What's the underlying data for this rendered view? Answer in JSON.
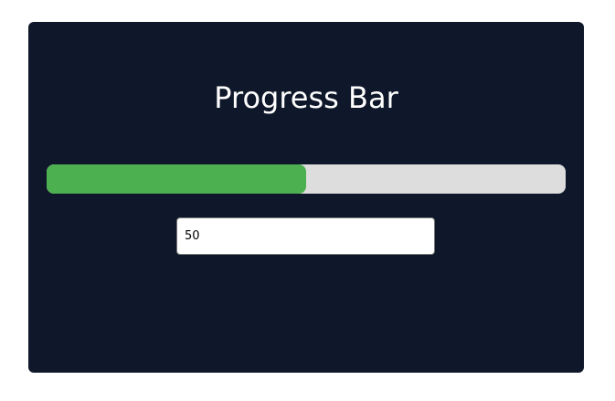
{
  "card": {
    "title": "Progress Bar"
  },
  "progress": {
    "value_percent": 50,
    "fill_color": "#4cb050",
    "track_color": "#dddddd"
  },
  "input": {
    "value": "50"
  },
  "colors": {
    "card_background": "#0f182a",
    "page_background": "#ffffff",
    "title_color": "#ffffff"
  }
}
